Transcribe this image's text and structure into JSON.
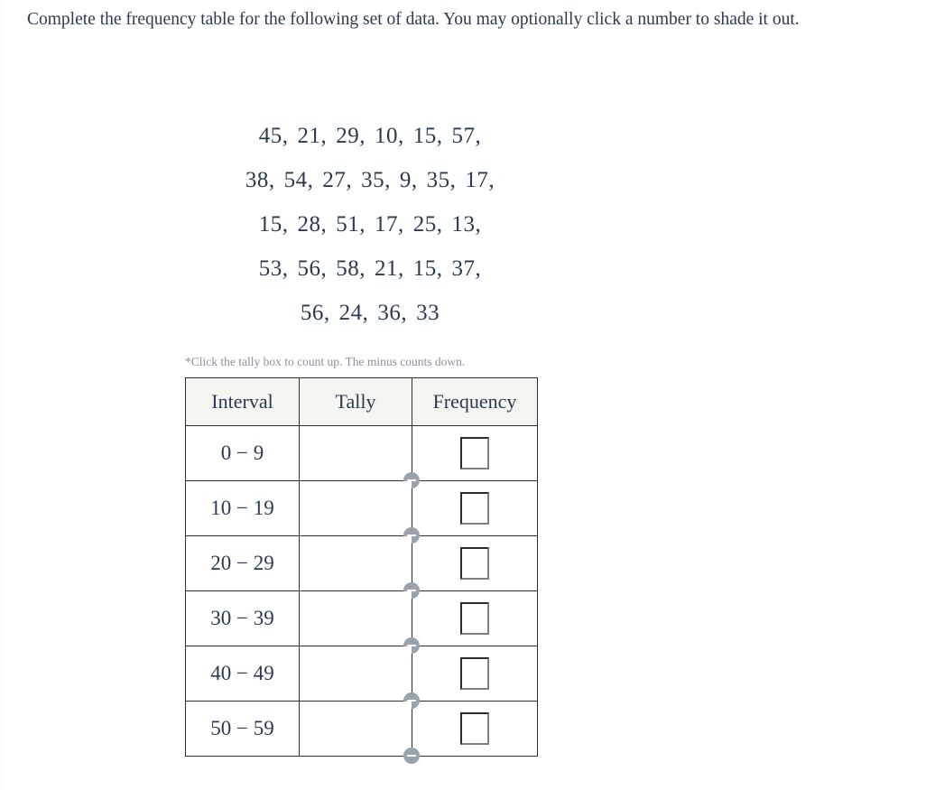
{
  "prompt": {
    "text": "Complete the frequency table for the following set of data. You may optionally click a number to shade it out."
  },
  "dataset": {
    "rows": [
      [
        "45",
        "21",
        "29",
        "10",
        "15",
        "57"
      ],
      [
        "38",
        "54",
        "27",
        "35",
        "9",
        "35",
        "17"
      ],
      [
        "15",
        "28",
        "51",
        "17",
        "25",
        "13"
      ],
      [
        "53",
        "56",
        "58",
        "21",
        "15",
        "37"
      ],
      [
        "56",
        "24",
        "36",
        "33"
      ]
    ],
    "separator": ","
  },
  "tally_note": {
    "text": "*Click the tally box to count up. The minus counts down."
  },
  "table": {
    "headers": [
      "Interval",
      "Tally",
      "Frequency"
    ],
    "rows": [
      {
        "interval": "0 − 9",
        "tally": "",
        "frequency": "",
        "minus_label": "−"
      },
      {
        "interval": "10 − 19",
        "tally": "",
        "frequency": "",
        "minus_label": "−"
      },
      {
        "interval": "20 − 29",
        "tally": "",
        "frequency": "",
        "minus_label": "−"
      },
      {
        "interval": "30 − 39",
        "tally": "",
        "frequency": "",
        "minus_label": "−"
      },
      {
        "interval": "40 − 49",
        "tally": "",
        "frequency": "",
        "minus_label": "−"
      },
      {
        "interval": "50 − 59",
        "tally": "",
        "frequency": "",
        "minus_label": "−"
      }
    ]
  },
  "colors": {
    "text": "#2b3a52",
    "note": "#8e9099",
    "header_bg": "#f4f5f1",
    "border": "#2f2f2f",
    "minus_button": "#9aa2ad",
    "page_bg": "#ffffff"
  }
}
